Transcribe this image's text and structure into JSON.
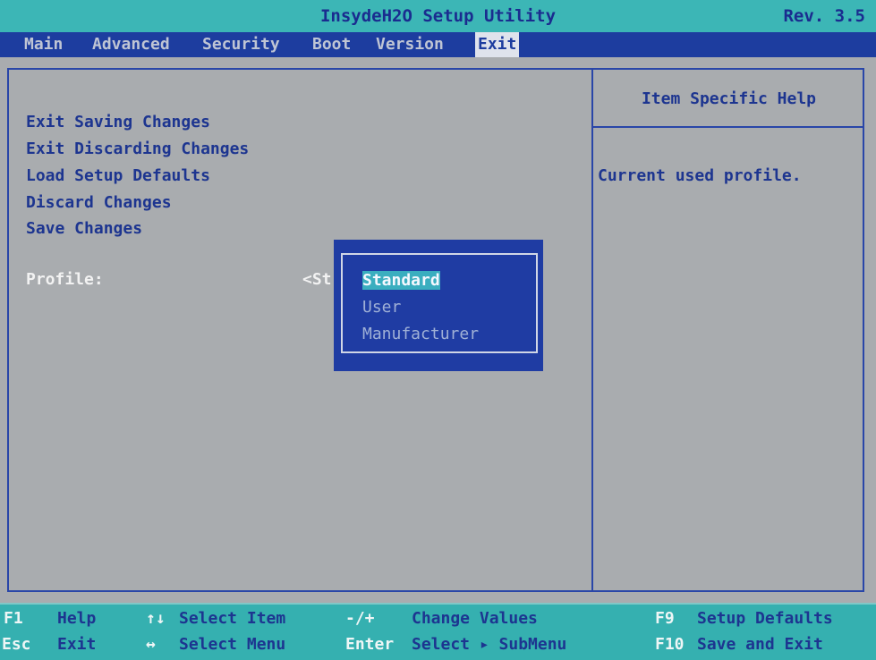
{
  "titlebar": {
    "title": "InsydeH2O Setup Utility",
    "revision": "Rev. 3.5"
  },
  "menu": {
    "items": [
      {
        "label": "Main"
      },
      {
        "label": "Advanced"
      },
      {
        "label": "Security"
      },
      {
        "label": "Boot"
      },
      {
        "label": "Version"
      },
      {
        "label": "Exit",
        "selected": true
      }
    ]
  },
  "exit_page": {
    "items": [
      {
        "label": "Exit Saving Changes"
      },
      {
        "label": "Exit Discarding Changes"
      },
      {
        "label": "Load Setup Defaults"
      },
      {
        "label": "Discard Changes"
      },
      {
        "label": "Save Changes"
      }
    ],
    "profile_label": "Profile:",
    "profile_value_visible": "<St"
  },
  "help_panel": {
    "title": "Item Specific Help",
    "text": "Current used profile."
  },
  "profile_popup": {
    "options": [
      {
        "label": "Standard",
        "selected": true
      },
      {
        "label": "User"
      },
      {
        "label": "Manufacturer"
      }
    ]
  },
  "footer": {
    "row1": [
      {
        "key": "F1",
        "desc": "Help"
      },
      {
        "key": "↑↓",
        "desc": "Select Item"
      },
      {
        "key": "-/+",
        "desc": "Change Values"
      },
      {
        "key": "F9",
        "desc": "Setup Defaults"
      }
    ],
    "row2": [
      {
        "key": "Esc",
        "desc": "Exit"
      },
      {
        "key": "↔",
        "desc": "Select Menu"
      },
      {
        "key": "Enter",
        "desc": "Select ▸ SubMenu"
      },
      {
        "key": "F10",
        "desc": "Save and Exit"
      }
    ]
  },
  "colors": {
    "menu_bar": "#1d3d9f",
    "title_bar": "#3cb6b6",
    "panel_background": "#a9acaf",
    "popup_background": "#1f3ca3",
    "selection_highlight": "#3aaebf"
  }
}
